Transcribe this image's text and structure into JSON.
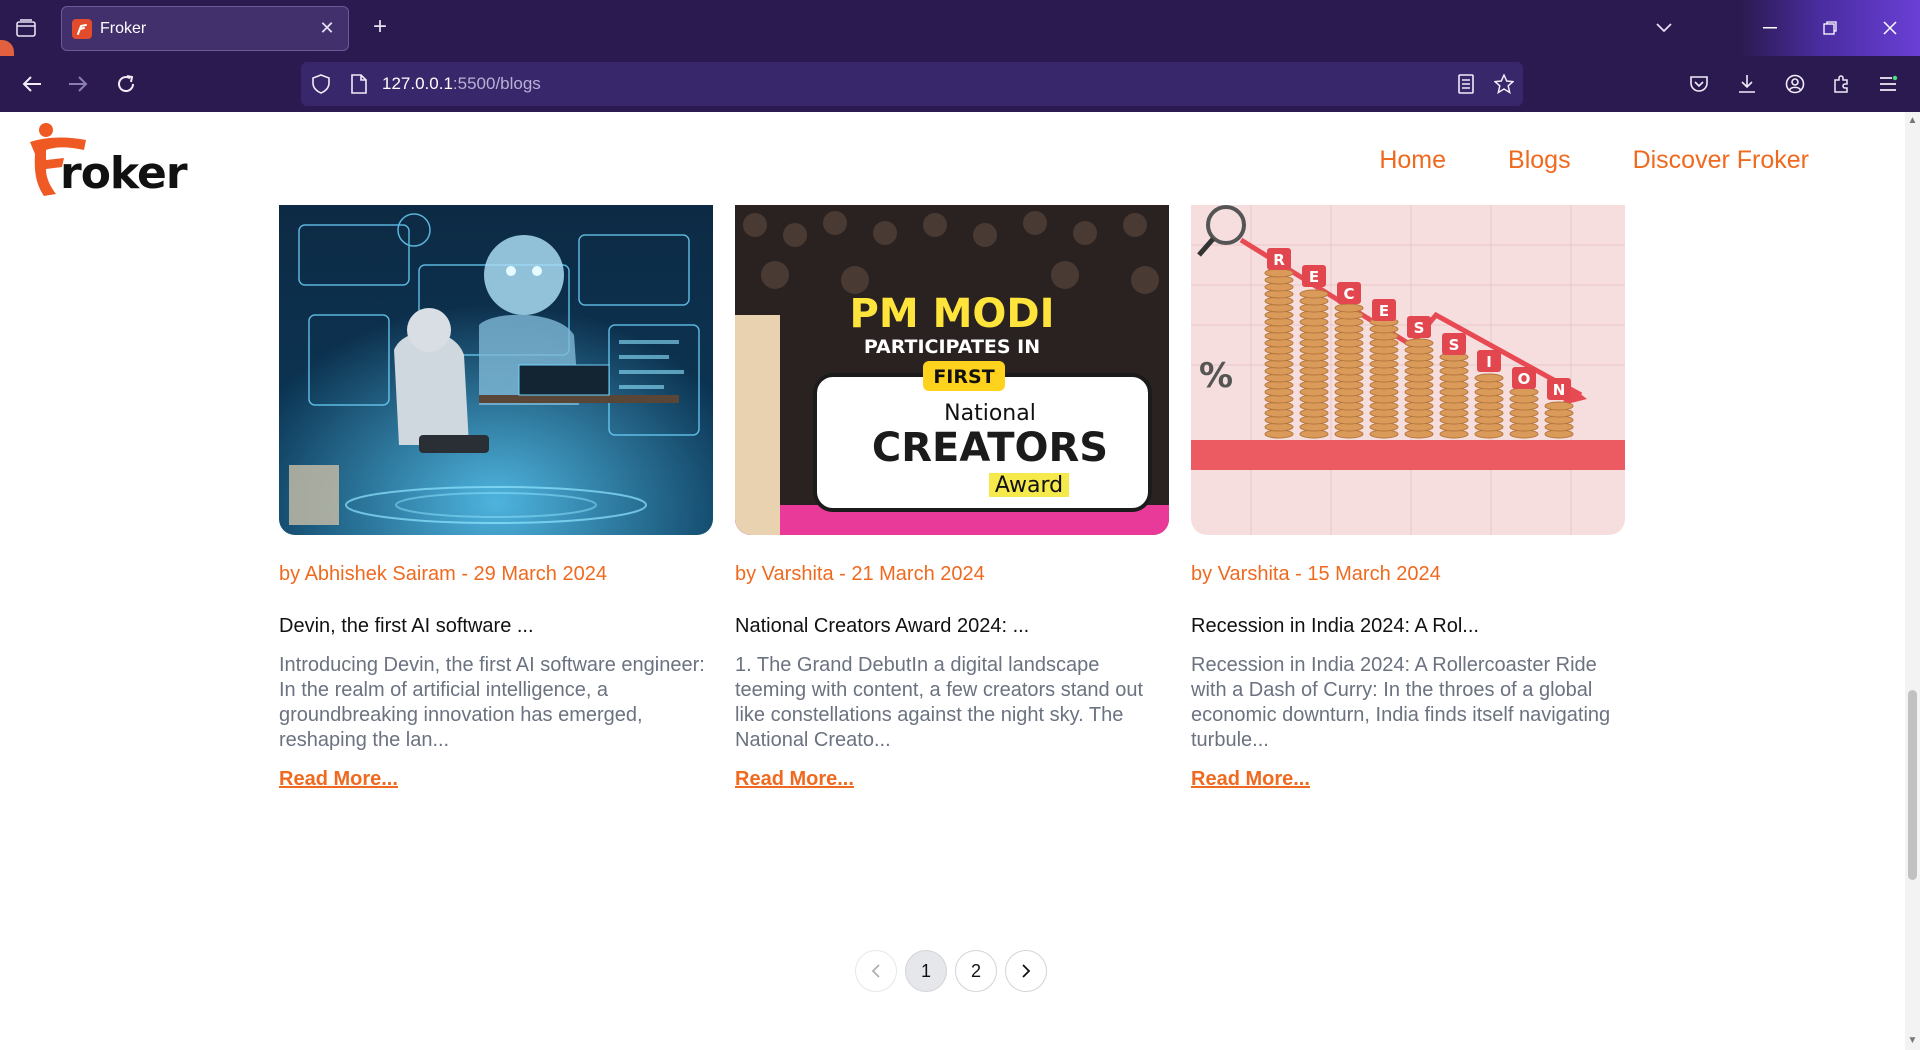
{
  "browser": {
    "tab_title": "Froker",
    "url_host": "127.0.0.1",
    "url_path": ":5500/blogs",
    "new_tab_label": "+",
    "close_tab_label": "✕"
  },
  "site": {
    "logo_text": "roker",
    "nav": [
      "Home",
      "Blogs",
      "Discover Froker"
    ]
  },
  "posts": [
    {
      "meta": "by Abhishek Sairam - 29 March 2024",
      "title": "Devin, the first AI software ...",
      "excerpt": "Introducing Devin, the first AI software engineer: In the realm of artificial intelligence, a groundbreaking innovation has emerged, reshaping the lan...",
      "link": "Read More..."
    },
    {
      "meta": "by Varshita - 21 March 2024",
      "title": "National Creators Award 2024: ...",
      "excerpt": "1. The Grand DebutIn a digital landscape teeming with content, a few creators stand out like constellations against the night sky. The National Creato...",
      "link": "Read More...",
      "image_text": {
        "line1": "PM MODI",
        "line2": "PARTICIPATES IN",
        "badge": "FIRST",
        "line3": "National",
        "line4": "CREATORS",
        "line5": "Award"
      }
    },
    {
      "meta": "by Varshita - 15 March 2024",
      "title": "Recession in India 2024: A Rol...",
      "excerpt": "Recession in India 2024: A Rollercoaster Ride with a Dash of Curry: In the throes of a global economic downturn, India finds itself navigating turbule...",
      "link": "Read More...",
      "image_text": {
        "letters": [
          "R",
          "E",
          "C",
          "E",
          "S",
          "S",
          "I",
          "O",
          "N"
        ],
        "percent": "%"
      }
    }
  ],
  "pagination": {
    "prev": "‹",
    "pages": [
      "1",
      "2"
    ],
    "next": "›",
    "current": "1"
  },
  "colors": {
    "accent": "#ef6a1f",
    "chrome": "#2b1a4f"
  }
}
